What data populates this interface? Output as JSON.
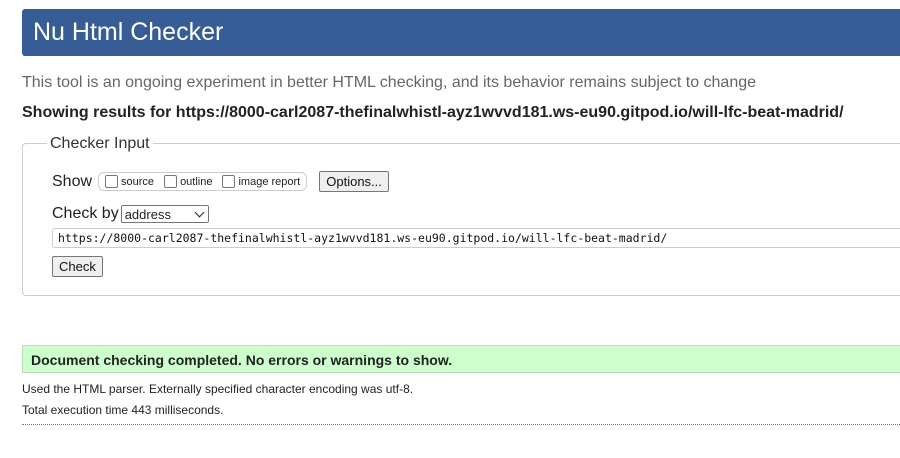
{
  "header": {
    "title": "Nu Html Checker",
    "background_color": "#365d95"
  },
  "intro": "This tool is an ongoing experiment in better HTML checking, and its behavior remains subject to change",
  "showing": "Showing results for https://8000-carl2087-thefinalwhistl-ayz1wvvd181.ws-eu90.gitpod.io/will-lfc-beat-madrid/",
  "checker_input": {
    "legend": "Checker Input",
    "show_label": "Show",
    "options": [
      {
        "label": "source",
        "checked": false
      },
      {
        "label": "outline",
        "checked": false
      },
      {
        "label": "image report",
        "checked": false
      }
    ],
    "options_button": "Options...",
    "check_by_label": "Check by",
    "check_by_selected": "address",
    "url_value": "https://8000-carl2087-thefinalwhistl-ayz1wvvd181.ws-eu90.gitpod.io/will-lfc-beat-madrid/",
    "check_button": "Check"
  },
  "result": {
    "message": "Document checking completed. No errors or warnings to show.",
    "color": "#ccffcc"
  },
  "details": {
    "parser": "Used the HTML parser. Externally specified character encoding was utf-8.",
    "time": "Total execution time 443 milliseconds."
  }
}
